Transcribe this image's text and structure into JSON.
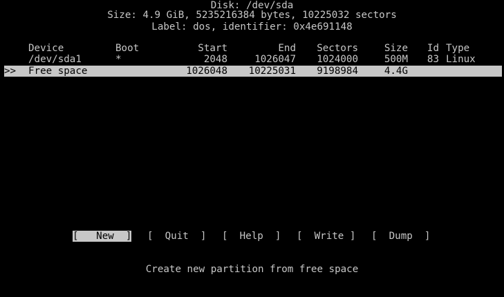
{
  "header": {
    "disk": "Disk: /dev/sda",
    "size": "Size: 4.9 GiB, 5235216384 bytes, 10225032 sectors",
    "label": "Label: dos, identifier: 0x4e691148"
  },
  "columns": {
    "device": "Device",
    "boot": "Boot",
    "start": "Start",
    "end": "End",
    "sectors": "Sectors",
    "size": "Size",
    "id": "Id",
    "type": "Type"
  },
  "rows": [
    {
      "marker": "",
      "device": "/dev/sda1",
      "boot": "*",
      "start": "2048",
      "end": "1026047",
      "sectors": "1024000",
      "size": "500M",
      "id": "83",
      "type": "Linux"
    },
    {
      "marker": ">>",
      "device": "Free space",
      "boot": "",
      "start": "1026048",
      "end": "10225031",
      "sectors": "9198984",
      "size": "4.4G",
      "id": "",
      "type": ""
    }
  ],
  "menu": {
    "new": "[   New  ]",
    "quit": "[  Quit  ]",
    "help": "[  Help  ]",
    "write": "[  Write ]",
    "dump": "[  Dump  ]"
  },
  "status": "Create new partition from free space",
  "colors": {
    "background": "#000000",
    "foreground": "#c7c7c7",
    "highlight_bg": "#c7c7c7",
    "highlight_fg": "#000000"
  }
}
